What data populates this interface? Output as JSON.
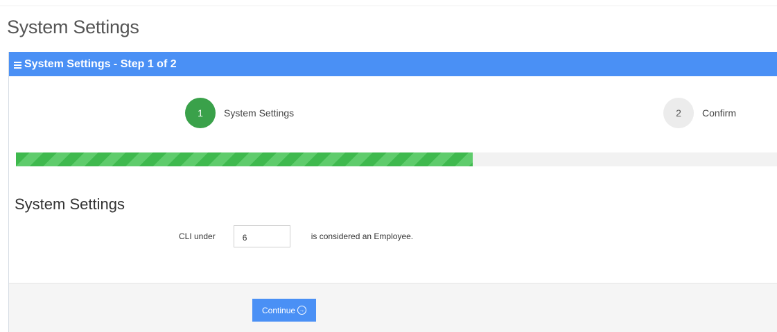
{
  "page": {
    "title": "System Settings"
  },
  "panel": {
    "header_title": "System Settings - Step 1 of 2",
    "header_icon": "menu-icon"
  },
  "wizard": {
    "steps": [
      {
        "number": "1",
        "label": "System Settings",
        "state": "active"
      },
      {
        "number": "2",
        "label": "Confirm",
        "state": "inactive"
      }
    ],
    "progress_fraction": 0.6
  },
  "form": {
    "section_title": "System Settings",
    "cli_label": "CLI under",
    "cli_value": "6",
    "cli_suffix": "is considered an Employee."
  },
  "footer": {
    "continue_label": "Continue",
    "continue_icon": "arrow-circle-right-icon"
  },
  "colors": {
    "accent": "#4a90f5",
    "step_active": "#3aa14a",
    "progress": "#3fb94e"
  }
}
